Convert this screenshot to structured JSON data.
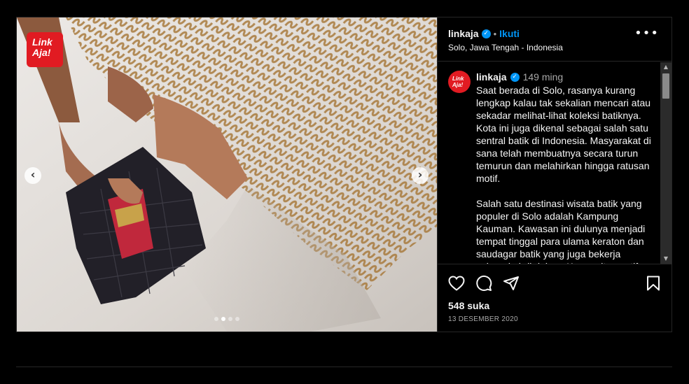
{
  "post": {
    "image": {
      "logo_line1": "Link",
      "logo_line2": "Aja!",
      "prev_arrow": "‹",
      "next_arrow": "›",
      "carousel_total": 4,
      "carousel_active": 2
    },
    "header": {
      "username": "linkaja",
      "verified_icon": "verified-badge-icon",
      "separator": "•",
      "follow_label": "Ikuti",
      "location": "Solo, Jawa Tengah - Indonesia",
      "more_icon": "more-options-icon"
    },
    "caption": {
      "avatar_line1": "Link",
      "avatar_line2": "Aja!",
      "username": "linkaja",
      "time": "149 ming",
      "paragraph1": "Saat berada di Solo, rasanya kurang lengkap kalau tak sekalian mencari atau sekadar melihat-lihat koleksi batiknya. Kota ini juga dikenal sebagai salah satu sentral batik di Indonesia. Masyarakat di sana telah membuatnya secara turun temurun dan melahirkan hingga ratusan motif.",
      "paragraph2": "Salah satu destinasi wisata batik yang populer di Solo adalah Kampung Kauman. Kawasan ini dulunya menjadi tempat tinggal para ulama keraton dan saudagar batik yang juga bekerja sebagai abdi dalem. Karena itu, motif batik"
    },
    "actions": {
      "like_icon": "heart-icon",
      "comment_icon": "comment-icon",
      "share_icon": "share-icon",
      "save_icon": "bookmark-icon",
      "likes": "548 suka",
      "date": "13 DESEMBER 2020"
    },
    "colors": {
      "brand_red": "#e11b22",
      "link_blue": "#0095f6",
      "background": "#000000",
      "border": "#262626"
    }
  }
}
